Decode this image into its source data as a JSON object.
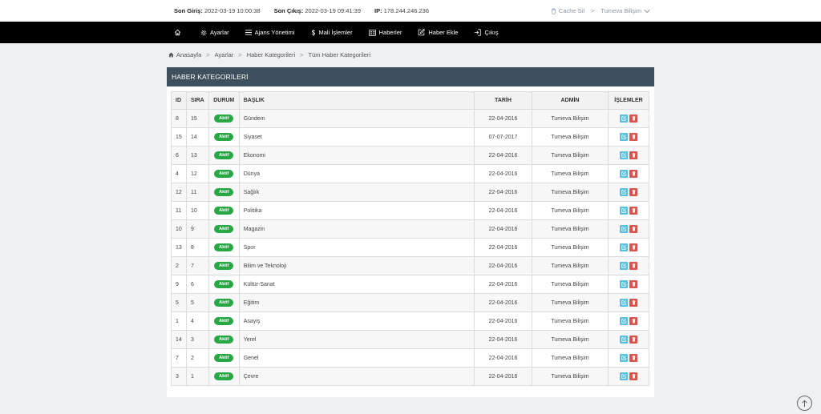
{
  "topbar": {
    "last_login_label": "Son Giriş:",
    "last_login_value": "2022-03-19 10:00:38",
    "last_logout_label": "Son Çıkış:",
    "last_logout_value": "2022-03-19 09:41:39",
    "ip_label": "IP:",
    "ip_value": "178.244.246.236",
    "cache_label": "Cache Sil",
    "separator": ">",
    "user_label": "Tumeva Bilişim"
  },
  "nav": {
    "home_icon": "home-icon",
    "items": [
      {
        "label": "Ayarlar",
        "icon": "gear-icon"
      },
      {
        "label": "Ajans Yönetimi",
        "icon": "list-icon"
      },
      {
        "label": "Mali İşlemler",
        "icon": "money-icon"
      },
      {
        "label": "Haberler",
        "icon": "newspaper-icon"
      },
      {
        "label": "Haber Ekle",
        "icon": "edit-icon"
      },
      {
        "label": "Çıkış",
        "icon": "logout-icon"
      }
    ]
  },
  "breadcrumb": {
    "sep": ">",
    "items": [
      "Anasayfa",
      "Ayarlar",
      "Haber Kategorileri",
      "Tüm Haber Kategorileri"
    ]
  },
  "panel": {
    "title": "HABER KATEGORİLERİ"
  },
  "table": {
    "headers": {
      "id": "ID",
      "sira": "SIRA",
      "durum": "DURUM",
      "baslik": "BAŞLIK",
      "tarih": "TARİH",
      "admin": "ADMİN",
      "islemler": "İŞLEMLER"
    },
    "rows": [
      {
        "id": "8",
        "sira": "15",
        "durum": "Aktif",
        "baslik": "Gündem",
        "tarih": "22-04-2016",
        "admin": "Tumeva Bilişim"
      },
      {
        "id": "15",
        "sira": "14",
        "durum": "Aktif",
        "baslik": "Siyaset",
        "tarih": "07-07-2017",
        "admin": "Tumeva Bilişim"
      },
      {
        "id": "6",
        "sira": "13",
        "durum": "Aktif",
        "baslik": "Ekonomi",
        "tarih": "22-04-2016",
        "admin": "Tumeva Bilişim"
      },
      {
        "id": "4",
        "sira": "12",
        "durum": "Aktif",
        "baslik": "Dünya",
        "tarih": "22-04-2016",
        "admin": "Tumeva Bilişim"
      },
      {
        "id": "12",
        "sira": "11",
        "durum": "Aktif",
        "baslik": "Sağlık",
        "tarih": "22-04-2016",
        "admin": "Tumeva Bilişim"
      },
      {
        "id": "11",
        "sira": "10",
        "durum": "Aktif",
        "baslik": "Politika",
        "tarih": "22-04-2016",
        "admin": "Tumeva Bilişim"
      },
      {
        "id": "10",
        "sira": "9",
        "durum": "Aktif",
        "baslik": "Magazin",
        "tarih": "22-04-2016",
        "admin": "Tumeva Bilişim"
      },
      {
        "id": "13",
        "sira": "8",
        "durum": "Aktif",
        "baslik": "Spor",
        "tarih": "22-04-2016",
        "admin": "Tumeva Bilişim"
      },
      {
        "id": "2",
        "sira": "7",
        "durum": "Aktif",
        "baslik": "Bilim ve Teknoloji",
        "tarih": "22-04-2016",
        "admin": "Tumeva Bilişim"
      },
      {
        "id": "9",
        "sira": "6",
        "durum": "Aktif",
        "baslik": "Kültür-Sanat",
        "tarih": "22-04-2016",
        "admin": "Tumeva Bilişim"
      },
      {
        "id": "5",
        "sira": "5",
        "durum": "Aktif",
        "baslik": "Eğitim",
        "tarih": "22-04-2016",
        "admin": "Tumeva Bilişim"
      },
      {
        "id": "1",
        "sira": "4",
        "durum": "Aktif",
        "baslik": "Asayiş",
        "tarih": "22-04-2016",
        "admin": "Tumeva Bilişim"
      },
      {
        "id": "14",
        "sira": "3",
        "durum": "Aktif",
        "baslik": "Yerel",
        "tarih": "22-04-2016",
        "admin": "Tumeva Bilişim"
      },
      {
        "id": "7",
        "sira": "2",
        "durum": "Aktif",
        "baslik": "Genel",
        "tarih": "22-04-2016",
        "admin": "Tumeva Bilişim"
      },
      {
        "id": "3",
        "sira": "1",
        "durum": "Aktif",
        "baslik": "Çevre",
        "tarih": "22-04-2016",
        "admin": "Tumeva Bilişim"
      }
    ]
  },
  "colors": {
    "navbar": "#000000",
    "panel_header": "#3e4f5e",
    "badge_active": "#28a745",
    "edit_button": "#5bc0de",
    "delete_button": "#d9534f"
  },
  "scroll_top_icon": "arrow-up-icon"
}
